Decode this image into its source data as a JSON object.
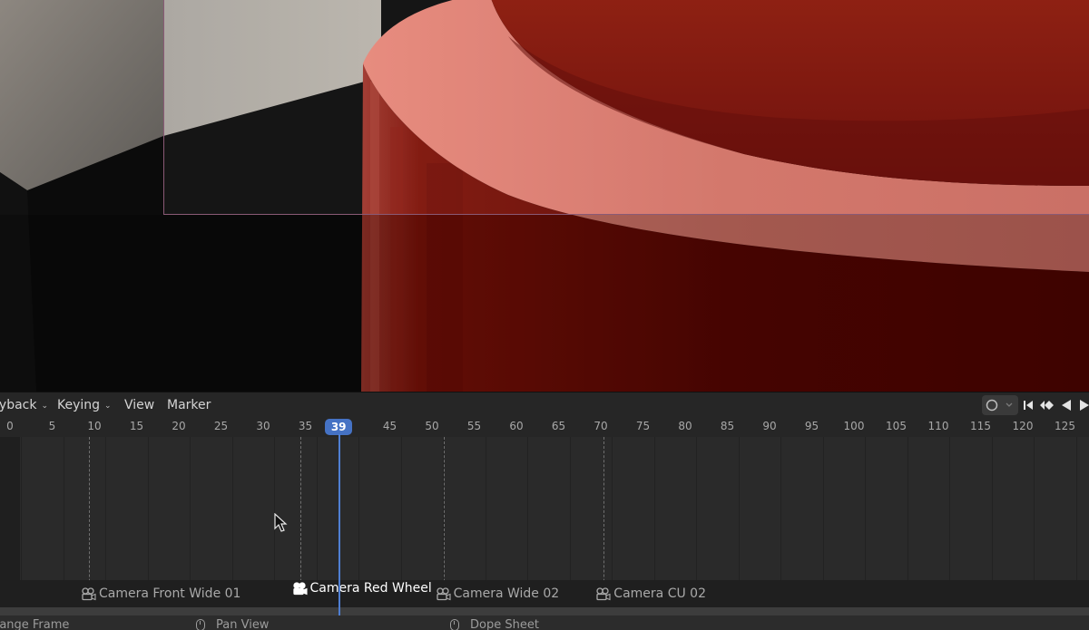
{
  "header": {
    "menus": [
      {
        "label": "Playback",
        "dropdown": true
      },
      {
        "label": "Keying",
        "dropdown": true
      },
      {
        "label": "View",
        "dropdown": false
      },
      {
        "label": "Marker",
        "dropdown": false
      }
    ],
    "controls": {
      "record_icon": "record-circle-icon",
      "jump_start_glyph": "⏮",
      "prev_keyframe_glyph": "◆",
      "play_reverse_glyph": "◀",
      "play_glyph": "▶"
    }
  },
  "ruler": {
    "ticks": [
      "0",
      "5",
      "10",
      "15",
      "20",
      "25",
      "30",
      "35",
      "40",
      "45",
      "50",
      "55",
      "60",
      "65",
      "70",
      "75",
      "80",
      "85",
      "90",
      "95",
      "100",
      "105",
      "110",
      "115",
      "120",
      "125"
    ],
    "current_frame": "39"
  },
  "markers": [
    {
      "label": "Camera Front Wide 01",
      "frame": 10,
      "active": false
    },
    {
      "label": "Camera Red Wheel",
      "frame": 35,
      "active": true
    },
    {
      "label": "Camera Wide 02",
      "frame": 52,
      "active": false
    },
    {
      "label": "Camera CU 02",
      "frame": 71,
      "active": false
    }
  ],
  "status_bar": {
    "items": [
      {
        "label": "Change Frame",
        "icon": "mouse-left-icon"
      },
      {
        "label": "Pan View",
        "icon": "mouse-middle-icon"
      },
      {
        "label": "Dope Sheet",
        "icon": "mouse-right-icon"
      }
    ]
  },
  "colors": {
    "playhead": "#4f7fd3",
    "red_object": "#8a0d05",
    "rim_highlight": "#d07468"
  }
}
